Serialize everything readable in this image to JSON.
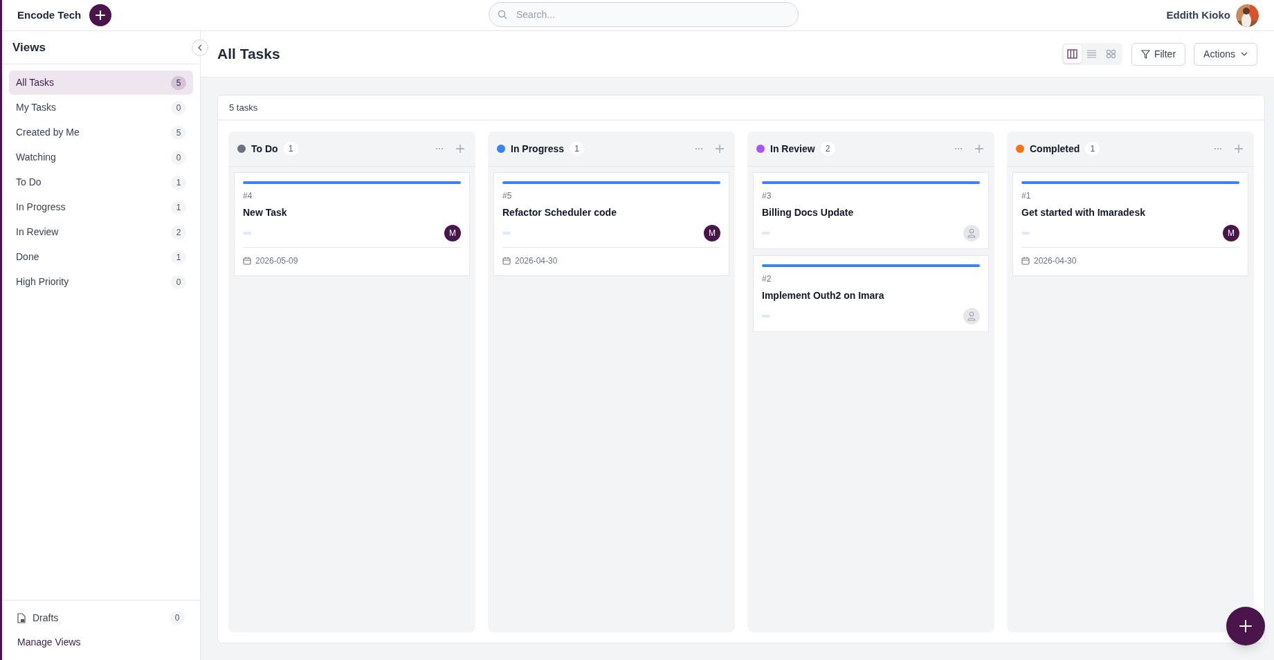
{
  "workspace": {
    "name": "Encode Tech"
  },
  "search": {
    "placeholder": "Search..."
  },
  "user": {
    "name": "Eddith Kioko"
  },
  "sidebar": {
    "title": "Views",
    "items": [
      {
        "label": "All Tasks",
        "count": "5",
        "selected": true
      },
      {
        "label": "My Tasks",
        "count": "0",
        "selected": false
      },
      {
        "label": "Created by Me",
        "count": "5",
        "selected": false
      },
      {
        "label": "Watching",
        "count": "0",
        "selected": false
      },
      {
        "label": "To Do",
        "count": "1",
        "selected": false
      },
      {
        "label": "In Progress",
        "count": "1",
        "selected": false
      },
      {
        "label": "In Review",
        "count": "2",
        "selected": false
      },
      {
        "label": "Done",
        "count": "1",
        "selected": false
      },
      {
        "label": "High Priority",
        "count": "0",
        "selected": false
      }
    ],
    "drafts": {
      "label": "Drafts",
      "count": "0"
    },
    "manage": "Manage Views"
  },
  "page": {
    "title": "All Tasks",
    "view_modes": [
      {
        "kind": "board",
        "selected": true
      },
      {
        "kind": "list",
        "selected": false
      },
      {
        "kind": "grid",
        "selected": false
      }
    ],
    "filter": "Filter",
    "actions": "Actions"
  },
  "board": {
    "summary": "5 tasks",
    "columns": [
      {
        "name": "To Do",
        "color": "#6b7280",
        "count": "1",
        "cards": [
          {
            "number": "#4",
            "title": "New Task",
            "assignee": "M",
            "date": "2026-05-09"
          }
        ]
      },
      {
        "name": "In Progress",
        "color": "#3b82f6",
        "count": "1",
        "cards": [
          {
            "number": "#5",
            "title": "Refactor Scheduler code",
            "assignee": "M",
            "date": "2026-04-30"
          }
        ]
      },
      {
        "name": "In Review",
        "color": "#a855f7",
        "count": "2",
        "cards": [
          {
            "number": "#3",
            "title": "Billing Docs Update"
          },
          {
            "number": "#2",
            "title": "Implement Outh2 on Imara"
          }
        ]
      },
      {
        "name": "Completed",
        "color": "#f97316",
        "count": "1",
        "cards": [
          {
            "number": "#1",
            "title": "Get started with Imaradesk",
            "assignee": "M",
            "date": "2026-04-30"
          }
        ]
      }
    ]
  }
}
